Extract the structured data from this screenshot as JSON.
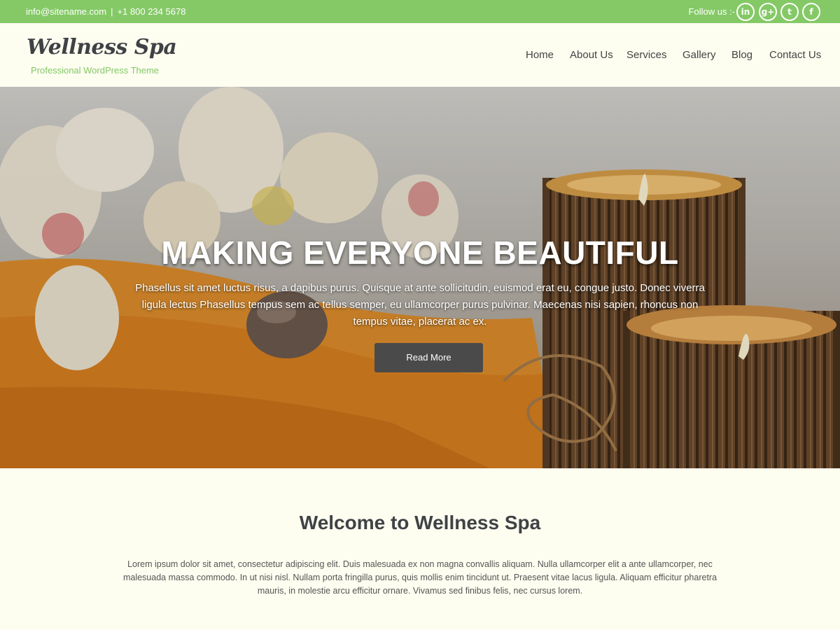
{
  "topbar": {
    "email": "info@sitename.com",
    "separator": "|",
    "phone": "+1 800 234 5678",
    "follow_label": "Follow us :-",
    "social": [
      {
        "icon": "linkedin-icon",
        "glyph": "in"
      },
      {
        "icon": "google-plus-icon",
        "glyph": "g+"
      },
      {
        "icon": "twitter-icon",
        "glyph": "t"
      },
      {
        "icon": "facebook-icon",
        "glyph": "f"
      }
    ]
  },
  "header": {
    "logo": "Wellness Spa",
    "tagline": "Professional WordPress Theme",
    "nav": [
      "Home",
      "About Us",
      "Services",
      "Gallery",
      "Blog",
      "Contact Us"
    ]
  },
  "hero": {
    "title": "MAKING EVERYONE BEAUTIFUL",
    "text": "Phasellus sit amet luctus risus, a dapibus purus. Quisque at ante sollicitudin, euismod erat eu, congue justo. Donec viverra ligula lectus Phasellus tempus sem ac tellus semper, eu ullamcorper purus pulvinar. Maecenas nisi sapien, rhoncus non tempus vitae, placerat ac ex.",
    "button": "Read More"
  },
  "welcome": {
    "title": "Welcome to Wellness Spa",
    "text": "Lorem ipsum dolor sit amet, consectetur adipiscing elit. Duis malesuada ex non magna convallis aliquam. Nulla ullamcorper elit a ante ullamcorper, nec malesuada massa commodo. In ut nisi nisl. Nullam porta fringilla purus, quis mollis enim tincidunt ut. Praesent vitae lacus ligula. Aliquam efficitur pharetra mauris, in molestie arcu efficitur ornare. Vivamus sed finibus felis, nec cursus lorem."
  },
  "colors": {
    "accent": "#84c966",
    "background": "#fdfdf0",
    "heading": "#3f4245",
    "button": "#4a4a4a"
  }
}
